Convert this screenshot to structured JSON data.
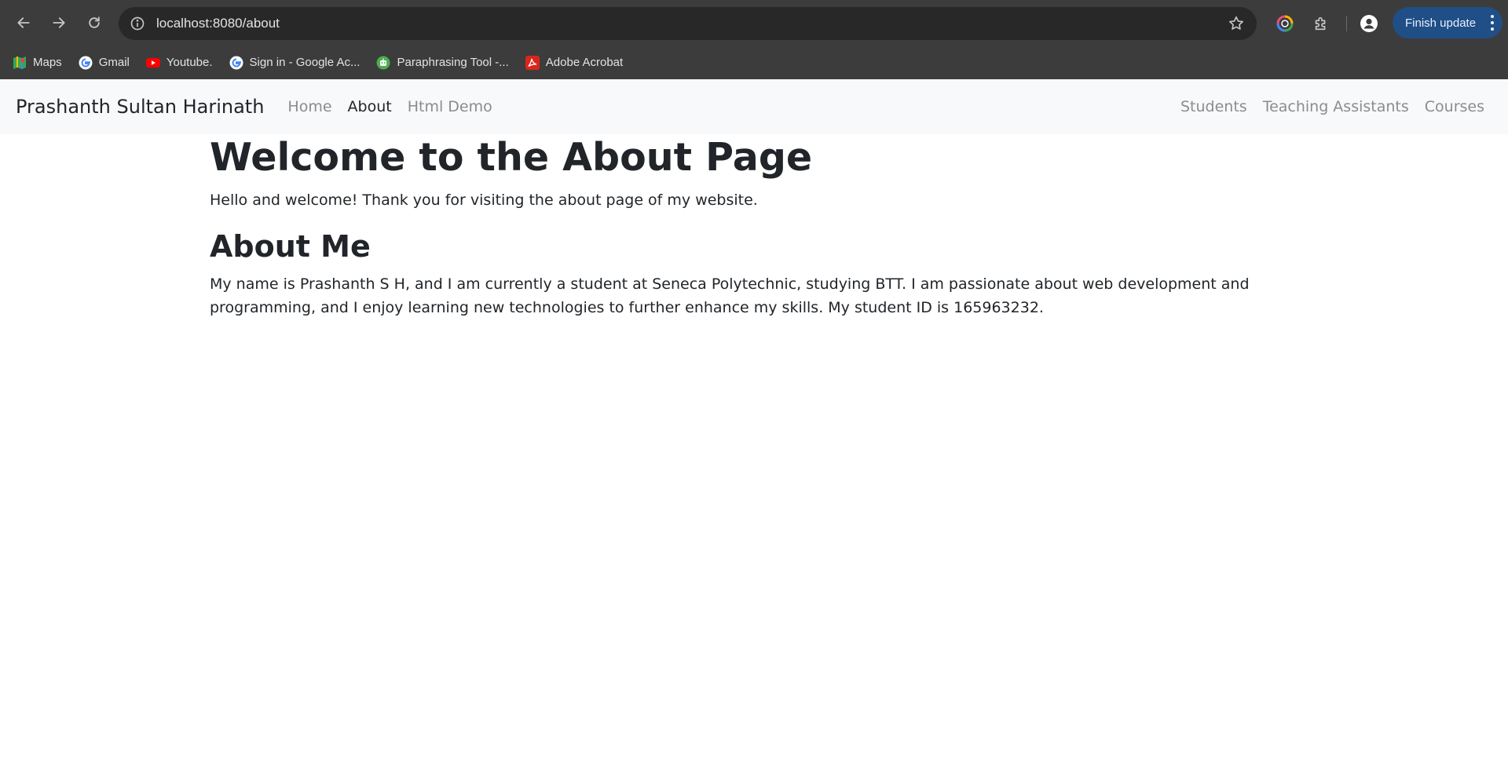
{
  "browser": {
    "url": "localhost:8080/about",
    "update_button": "Finish update",
    "bookmarks": [
      {
        "label": "Maps",
        "icon": "maps-icon"
      },
      {
        "label": "Gmail",
        "icon": "google-icon"
      },
      {
        "label": "Youtube.",
        "icon": "youtube-icon"
      },
      {
        "label": "Sign in - Google Ac...",
        "icon": "google-icon"
      },
      {
        "label": "Paraphrasing Tool -...",
        "icon": "robot-icon"
      },
      {
        "label": "Adobe Acrobat",
        "icon": "acrobat-icon"
      }
    ]
  },
  "site": {
    "brand": "Prashanth Sultan Harinath",
    "nav_left": [
      "Home",
      "About",
      "Html Demo"
    ],
    "nav_right": [
      "Students",
      "Teaching Assistants",
      "Courses"
    ],
    "active": "About"
  },
  "page": {
    "title": "Welcome to the About Page",
    "intro": "Hello and welcome! Thank you for visiting the about page of my website.",
    "about_heading": "About Me",
    "about_text": "My name is Prashanth S H, and I am currently a student at Seneca Polytechnic, studying BTT. I am passionate about web development and programming, and I enjoy learning new technologies to further enhance my skills. My student ID is 165963232."
  },
  "colors": {
    "chrome_bg": "#3c3c3c",
    "omnibox_bg": "#282828",
    "update_btn": "#1f4f86",
    "navbar_bg": "#f8f9fa",
    "text": "#212529",
    "muted_link": "#8c8c8c"
  }
}
